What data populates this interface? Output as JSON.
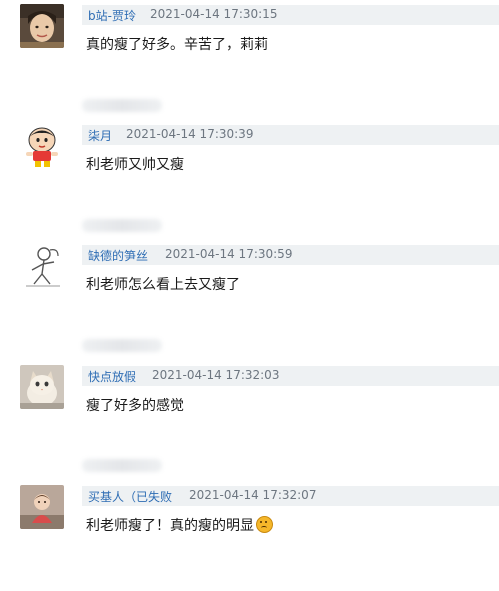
{
  "comments": [
    {
      "user": "b站-贾玲",
      "time": "2021-04-14 17:30:15",
      "text": "真的瘦了好多。辛苦了，莉莉",
      "avatar_icon": "woman-photo-avatar"
    },
    {
      "user": "柒月",
      "time": "2021-04-14 17:30:39",
      "text": "利老师又帅又瘦",
      "avatar_icon": "cartoon-boy-avatar"
    },
    {
      "user": "缺德的笋丝",
      "time": "2021-04-14 17:30:59",
      "text": "利老师怎么看上去又瘦了",
      "avatar_icon": "sketch-figure-avatar"
    },
    {
      "user": "快点放假",
      "time": "2021-04-14 17:32:03",
      "text": "瘦了好多的感觉",
      "avatar_icon": "cat-photo-avatar"
    },
    {
      "user": "买基人（已失败",
      "time": "2021-04-14 17:32:07",
      "text": "利老师瘦了！真的瘦的明显",
      "avatar_icon": "child-photo-avatar",
      "trailing_emoji": "sad-face-emoji"
    }
  ],
  "colors": {
    "username": "#2e6db4",
    "meta_background": "#eef1f3",
    "timestamp": "#6d7680"
  }
}
